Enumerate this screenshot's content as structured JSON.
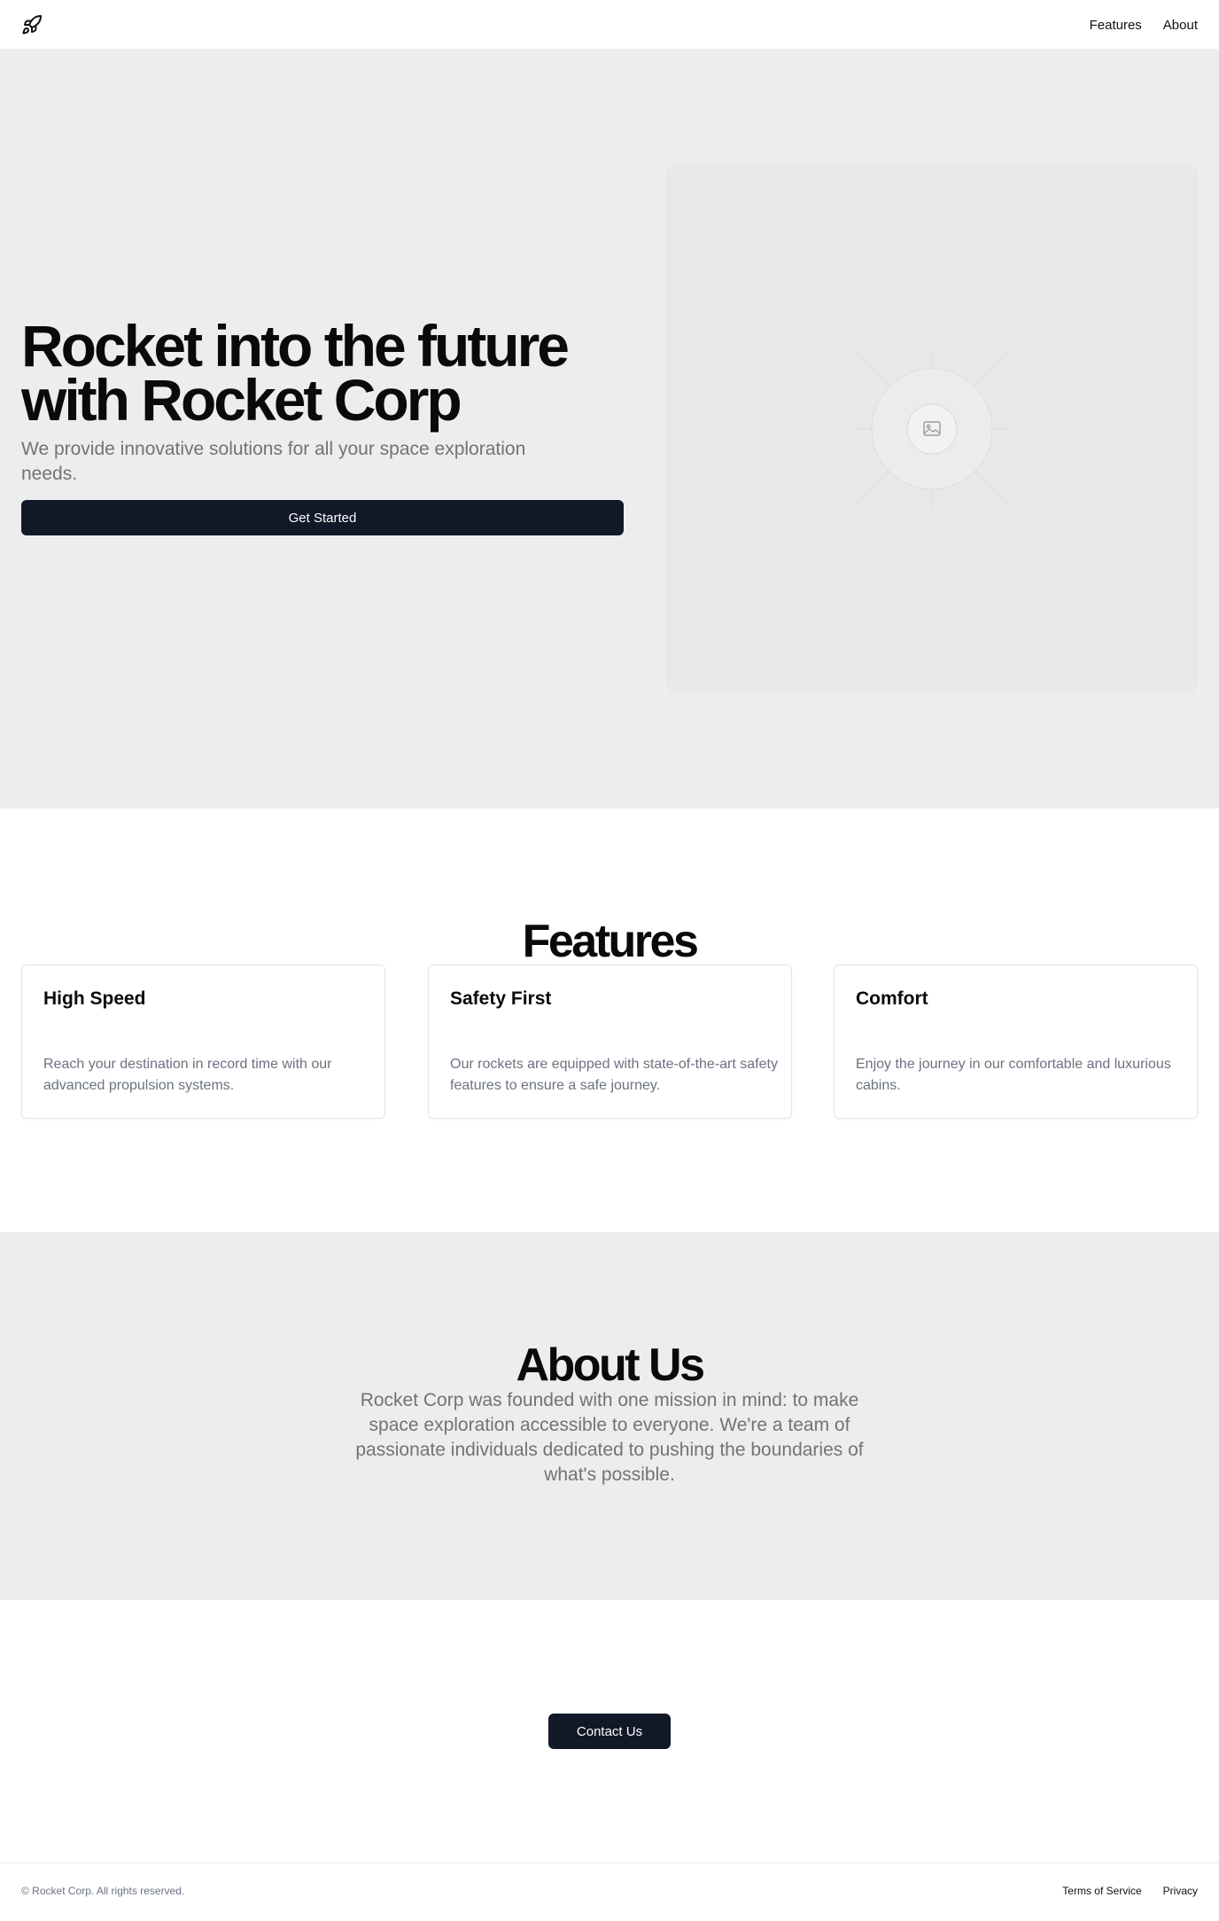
{
  "header": {
    "logo_icon": "rocket-icon",
    "nav": [
      {
        "label": "Features"
      },
      {
        "label": "About"
      }
    ]
  },
  "hero": {
    "title": "Rocket into the future with Rocket Corp",
    "subtitle": "We provide innovative solutions for all your space exploration needs.",
    "cta_label": "Get Started",
    "image_icon": "image-placeholder-icon"
  },
  "features": {
    "title": "Features",
    "items": [
      {
        "title": "High Speed",
        "text": "Reach your destination in record time with our advanced propulsion systems."
      },
      {
        "title": "Safety First",
        "text": "Our rockets are equipped with state-of-the-art safety features to ensure a safe journey."
      },
      {
        "title": "Comfort",
        "text": "Enjoy the journey in our comfortable and luxurious cabins."
      }
    ]
  },
  "about": {
    "title": "About Us",
    "text": "Rocket Corp was founded with one mission in mind: to make space exploration accessible to everyone. We're a team of passionate individuals dedicated to pushing the boundaries of what's possible."
  },
  "contact": {
    "label": "Contact Us"
  },
  "footer": {
    "copyright": "© Rocket Corp. All rights reserved.",
    "links": [
      {
        "label": "Terms of Service"
      },
      {
        "label": "Privacy"
      }
    ]
  },
  "colors": {
    "primary_button": "#111827",
    "section_bg": "#ededed",
    "muted_text": "#737373"
  }
}
